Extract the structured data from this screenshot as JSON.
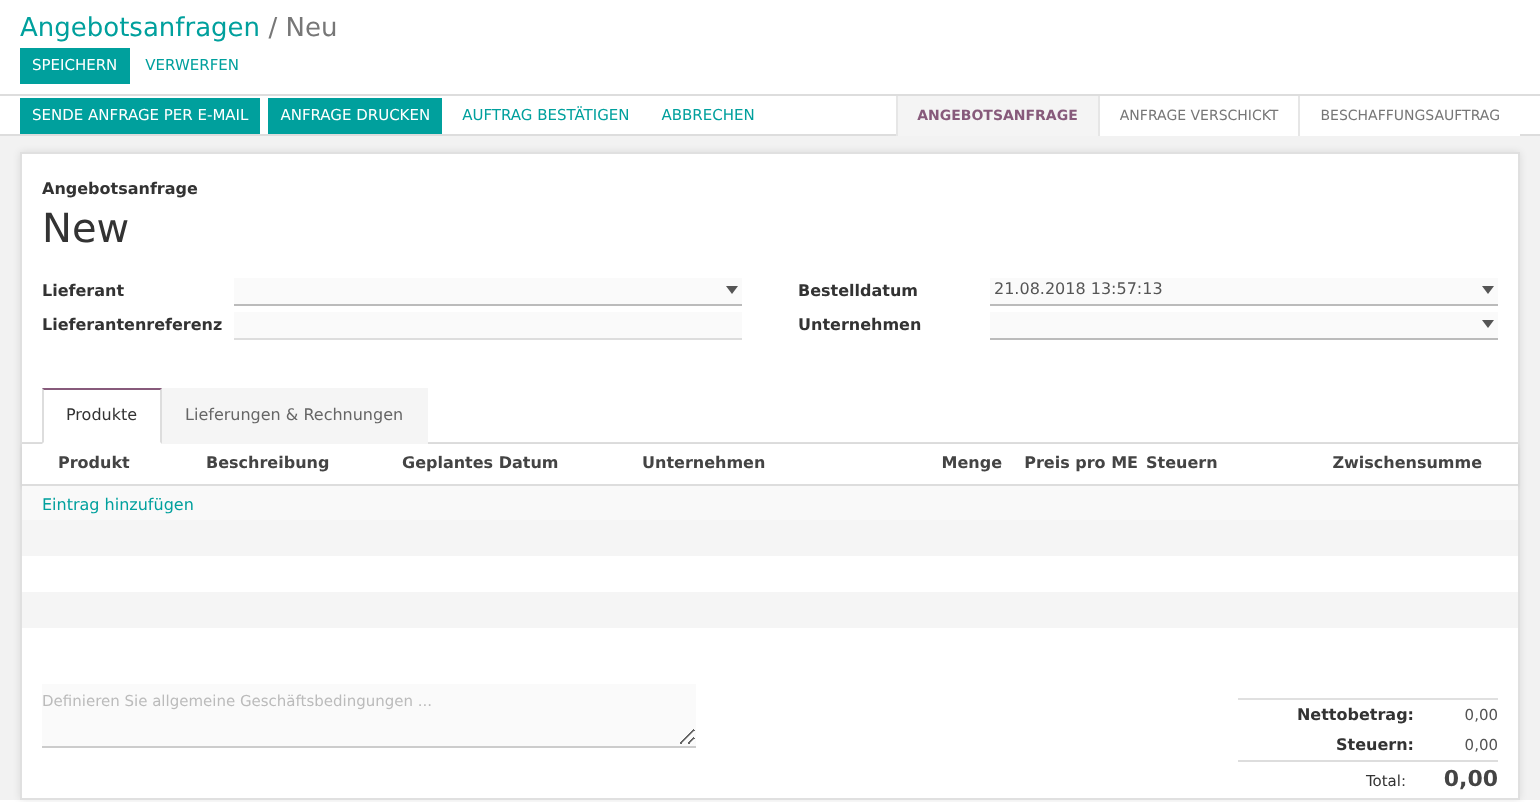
{
  "breadcrumb": {
    "parent": "Angebotsanfragen",
    "separator": "/",
    "current": "Neu"
  },
  "control_buttons": [
    {
      "label": "SPEICHERN",
      "kind": "primary"
    },
    {
      "label": "VERWERFEN",
      "kind": "link"
    }
  ],
  "header_buttons": [
    {
      "label": "SENDE ANFRAGE PER E-MAIL",
      "kind": "primary"
    },
    {
      "label": "ANFRAGE DRUCKEN",
      "kind": "primary"
    },
    {
      "label": "AUFTRAG BESTÄTIGEN",
      "kind": "link"
    },
    {
      "label": "ABBRECHEN",
      "kind": "link"
    }
  ],
  "stages": [
    {
      "label": "ANGEBOTSANFRAGE",
      "selected": true
    },
    {
      "label": "ANFRAGE VERSCHICKT",
      "selected": false
    },
    {
      "label": "BESCHAFFUNGSAUFTRAG",
      "selected": false
    }
  ],
  "sheet": {
    "subtitle": "Angebotsanfrage",
    "title": "New",
    "left_fields": [
      {
        "label": "Lieferant",
        "kind": "select"
      },
      {
        "label": "Lieferantenreferenz",
        "kind": "text"
      }
    ],
    "right_fields": [
      {
        "label": "Bestelldatum",
        "kind": "select",
        "value": "21.08.2018 13:57:13"
      },
      {
        "label": "Unternehmen",
        "kind": "select"
      }
    ],
    "tabs": [
      {
        "label": "Produkte",
        "selected": true
      },
      {
        "label": "Lieferungen & Rechnungen",
        "selected": false
      }
    ],
    "table": {
      "columns": [
        "Produkt",
        "Beschreibung",
        "Geplantes Datum",
        "Unternehmen",
        "Menge",
        "Preis pro ME",
        "Steuern",
        "Zwischensumme"
      ],
      "add_line": "Eintrag hinzufügen"
    },
    "notes": {
      "placeholder": "Definieren Sie allgemeine Geschäftsbedingungen ..."
    },
    "totals": [
      {
        "label": "Nettobetrag:",
        "value": "0,00",
        "kind": "line"
      },
      {
        "label": "Steuern:",
        "value": "0,00",
        "kind": "line"
      },
      {
        "label": "Total:",
        "value": "0,00",
        "kind": "total"
      }
    ]
  }
}
